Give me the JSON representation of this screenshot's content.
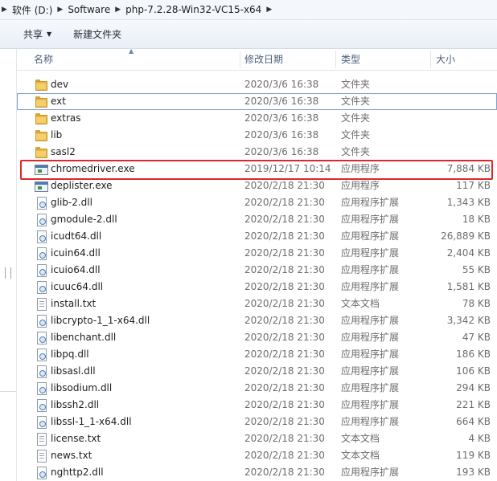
{
  "address": {
    "segments": [
      "软件 (D:)",
      "Software",
      "php-7.2.28-Win32-VC15-x64"
    ]
  },
  "toolbar": {
    "share_label": "共享",
    "new_folder_label": "新建文件夹"
  },
  "columns": {
    "name": "名称",
    "date": "修改日期",
    "type": "类型",
    "size": "大小"
  },
  "files": [
    {
      "name": "dev",
      "date": "2020/3/6 16:38",
      "type": "文件夹",
      "size": "",
      "icon": "folder-icon"
    },
    {
      "name": "ext",
      "date": "2020/3/6 16:38",
      "type": "文件夹",
      "size": "",
      "icon": "folder-icon"
    },
    {
      "name": "extras",
      "date": "2020/3/6 16:38",
      "type": "文件夹",
      "size": "",
      "icon": "folder-icon"
    },
    {
      "name": "lib",
      "date": "2020/3/6 16:38",
      "type": "文件夹",
      "size": "",
      "icon": "folder-icon"
    },
    {
      "name": "sasl2",
      "date": "2020/3/6 16:38",
      "type": "文件夹",
      "size": "",
      "icon": "folder-icon"
    },
    {
      "name": "chromedriver.exe",
      "date": "2019/12/17 10:14",
      "type": "应用程序",
      "size": "7,884 KB",
      "icon": "exe-icon"
    },
    {
      "name": "deplister.exe",
      "date": "2020/2/18 21:30",
      "type": "应用程序",
      "size": "117 KB",
      "icon": "exe-icon"
    },
    {
      "name": "glib-2.dll",
      "date": "2020/2/18 21:30",
      "type": "应用程序扩展",
      "size": "1,343 KB",
      "icon": "dll-icon"
    },
    {
      "name": "gmodule-2.dll",
      "date": "2020/2/18 21:30",
      "type": "应用程序扩展",
      "size": "18 KB",
      "icon": "dll-icon"
    },
    {
      "name": "icudt64.dll",
      "date": "2020/2/18 21:30",
      "type": "应用程序扩展",
      "size": "26,889 KB",
      "icon": "dll-icon"
    },
    {
      "name": "icuin64.dll",
      "date": "2020/2/18 21:30",
      "type": "应用程序扩展",
      "size": "2,404 KB",
      "icon": "dll-icon"
    },
    {
      "name": "icuio64.dll",
      "date": "2020/2/18 21:30",
      "type": "应用程序扩展",
      "size": "55 KB",
      "icon": "dll-icon"
    },
    {
      "name": "icuuc64.dll",
      "date": "2020/2/18 21:30",
      "type": "应用程序扩展",
      "size": "1,581 KB",
      "icon": "dll-icon"
    },
    {
      "name": "install.txt",
      "date": "2020/2/18 21:30",
      "type": "文本文档",
      "size": "78 KB",
      "icon": "text-file-icon"
    },
    {
      "name": "libcrypto-1_1-x64.dll",
      "date": "2020/2/18 21:30",
      "type": "应用程序扩展",
      "size": "3,342 KB",
      "icon": "dll-icon"
    },
    {
      "name": "libenchant.dll",
      "date": "2020/2/18 21:30",
      "type": "应用程序扩展",
      "size": "47 KB",
      "icon": "dll-icon"
    },
    {
      "name": "libpq.dll",
      "date": "2020/2/18 21:30",
      "type": "应用程序扩展",
      "size": "186 KB",
      "icon": "dll-icon"
    },
    {
      "name": "libsasl.dll",
      "date": "2020/2/18 21:30",
      "type": "应用程序扩展",
      "size": "106 KB",
      "icon": "dll-icon"
    },
    {
      "name": "libsodium.dll",
      "date": "2020/2/18 21:30",
      "type": "应用程序扩展",
      "size": "294 KB",
      "icon": "dll-icon"
    },
    {
      "name": "libssh2.dll",
      "date": "2020/2/18 21:30",
      "type": "应用程序扩展",
      "size": "221 KB",
      "icon": "dll-icon"
    },
    {
      "name": "libssl-1_1-x64.dll",
      "date": "2020/2/18 21:30",
      "type": "应用程序扩展",
      "size": "664 KB",
      "icon": "dll-icon"
    },
    {
      "name": "license.txt",
      "date": "2020/2/18 21:30",
      "type": "文本文档",
      "size": "4 KB",
      "icon": "text-file-icon"
    },
    {
      "name": "news.txt",
      "date": "2020/2/18 21:30",
      "type": "文本文档",
      "size": "119 KB",
      "icon": "text-file-icon"
    },
    {
      "name": "nghttp2.dll",
      "date": "2020/2/18 21:30",
      "type": "应用程序扩展",
      "size": "193 KB",
      "icon": "dll-icon"
    }
  ],
  "selected_outline_index": 1,
  "highlighted_index": 5,
  "colors": {
    "highlight": "#e0262a",
    "folder": "#e8b84a",
    "selection_outline": "#7da2ce"
  }
}
